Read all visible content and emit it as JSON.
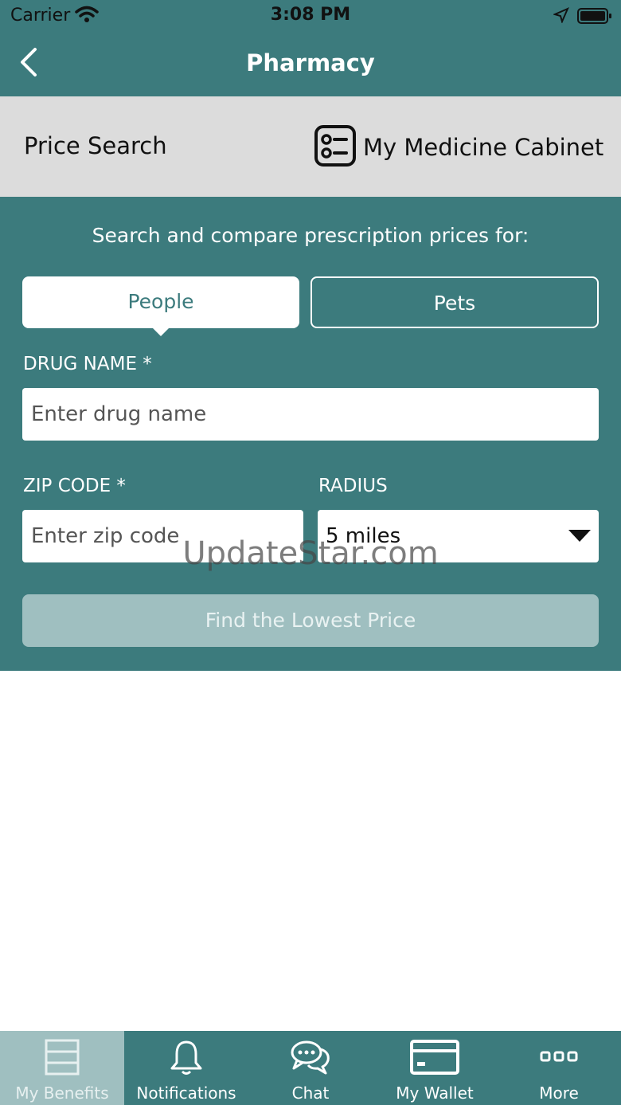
{
  "status_bar": {
    "carrier": "Carrier",
    "time": "3:08 PM"
  },
  "nav": {
    "title": "Pharmacy"
  },
  "subheader": {
    "price_search": "Price Search",
    "cabinet_label": "My Medicine Cabinet"
  },
  "form": {
    "prompt": "Search and compare prescription prices for:",
    "segments": {
      "people": "People",
      "pets": "Pets",
      "selected": "People"
    },
    "drug_label": "DRUG NAME *",
    "drug_placeholder": "Enter drug name",
    "zip_label": "ZIP CODE *",
    "zip_placeholder": "Enter zip code",
    "radius_label": "RADIUS",
    "radius_value": "5 miles",
    "submit_label": "Find the Lowest Price"
  },
  "watermark": "UpdateStar.com",
  "tab_bar": {
    "items": [
      {
        "label": "My Benefits",
        "icon": "benefits-icon",
        "active": true
      },
      {
        "label": "Notifications",
        "icon": "bell-icon",
        "active": false
      },
      {
        "label": "Chat",
        "icon": "chat-icon",
        "active": false
      },
      {
        "label": "My Wallet",
        "icon": "wallet-icon",
        "active": false
      },
      {
        "label": "More",
        "icon": "more-icon",
        "active": false
      }
    ]
  },
  "colors": {
    "primary": "#3c7b7d",
    "active_tab": "#9fbfc0",
    "subheader_bg": "#dcdcdc",
    "disabled_button": "#9fbfc0"
  }
}
